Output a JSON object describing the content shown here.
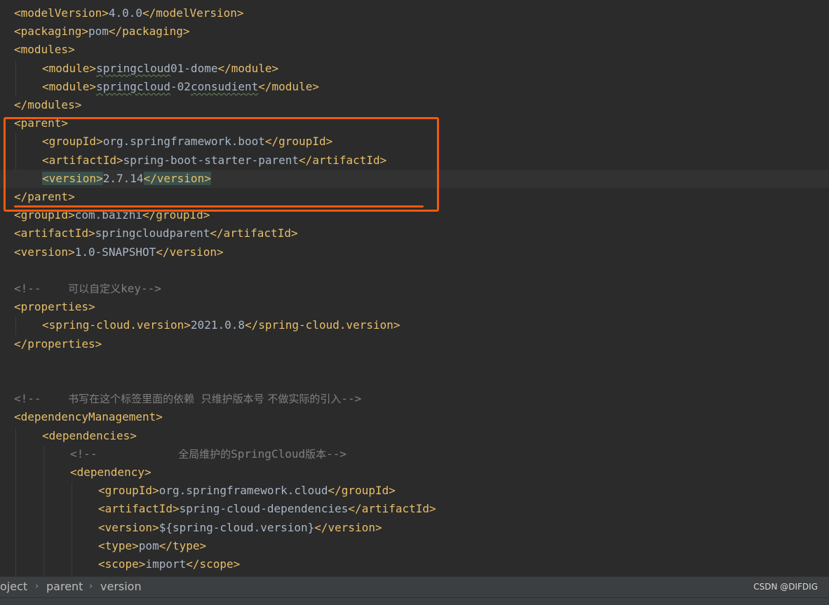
{
  "editor": {
    "lines": [
      {
        "i": 0,
        "parts": [
          [
            "tag",
            "<modelVersion>"
          ],
          [
            "txt",
            "4.0.0"
          ],
          [
            "tag",
            "</modelVersion>"
          ]
        ]
      },
      {
        "i": 0,
        "parts": [
          [
            "tag",
            "<packaging>"
          ],
          [
            "txt",
            "pom"
          ],
          [
            "tag",
            "</packaging>"
          ]
        ]
      },
      {
        "i": 0,
        "parts": [
          [
            "tag",
            "<modules>"
          ]
        ]
      },
      {
        "i": 1,
        "parts": [
          [
            "tag",
            "<module>"
          ],
          [
            "squig",
            "springcloud"
          ],
          [
            "txt",
            "01-dome"
          ],
          [
            "tag",
            "</module>"
          ]
        ]
      },
      {
        "i": 1,
        "parts": [
          [
            "tag",
            "<module>"
          ],
          [
            "squig",
            "springcloud"
          ],
          [
            "txt",
            "-02"
          ],
          [
            "squig",
            "consudient"
          ],
          [
            "tag",
            "</module>"
          ]
        ]
      },
      {
        "i": 0,
        "parts": [
          [
            "tag",
            "</modules>"
          ]
        ]
      },
      {
        "i": 0,
        "parts": [
          [
            "tag",
            "<parent>"
          ]
        ]
      },
      {
        "i": 1,
        "parts": [
          [
            "tag",
            "<groupId>"
          ],
          [
            "txt",
            "org.springframework.boot"
          ],
          [
            "tag",
            "</groupId>"
          ]
        ]
      },
      {
        "i": 1,
        "parts": [
          [
            "tag",
            "<artifactId>"
          ],
          [
            "txt",
            "spring-boot-starter-parent"
          ],
          [
            "tag",
            "</artifactId>"
          ]
        ]
      },
      {
        "i": 1,
        "hl": true,
        "parts": [
          [
            "hltag",
            "<version>"
          ],
          [
            "txt",
            "2.7.14"
          ],
          [
            "hltag",
            "</version>"
          ]
        ]
      },
      {
        "i": 0,
        "parts": [
          [
            "tag",
            "</parent>"
          ]
        ]
      },
      {
        "i": 0,
        "parts": [
          [
            "tag",
            "<groupId>"
          ],
          [
            "txt",
            "com.baizhi"
          ],
          [
            "tag",
            "</groupId>"
          ]
        ]
      },
      {
        "i": 0,
        "parts": [
          [
            "tag",
            "<artifactId>"
          ],
          [
            "txt",
            "springcloudparent"
          ],
          [
            "tag",
            "</artifactId>"
          ]
        ]
      },
      {
        "i": 0,
        "parts": [
          [
            "tag",
            "<version>"
          ],
          [
            "txt",
            "1.0-SNAPSHOT"
          ],
          [
            "tag",
            "</version>"
          ]
        ]
      },
      {
        "i": 0,
        "parts": []
      },
      {
        "i": 0,
        "parts": [
          [
            "cmt",
            "<!--    "
          ],
          [
            "cmtcjk",
            "可以自定义"
          ],
          [
            "cmt",
            "key-->"
          ]
        ]
      },
      {
        "i": 0,
        "parts": [
          [
            "tag",
            "<properties>"
          ]
        ]
      },
      {
        "i": 1,
        "parts": [
          [
            "tag",
            "<spring-cloud.version>"
          ],
          [
            "txt",
            "2021.0.8"
          ],
          [
            "tag",
            "</spring-cloud.version>"
          ]
        ]
      },
      {
        "i": 0,
        "parts": [
          [
            "tag",
            "</properties>"
          ]
        ]
      },
      {
        "i": 0,
        "parts": []
      },
      {
        "i": 0,
        "parts": []
      },
      {
        "i": 0,
        "parts": [
          [
            "cmt",
            "<!--    "
          ],
          [
            "cmtcjk",
            "书写在这个标签里面的依赖  只维护版本号 不做实际的引入"
          ],
          [
            "cmt",
            "-->"
          ]
        ]
      },
      {
        "i": 0,
        "parts": [
          [
            "tag",
            "<dependencyManagement>"
          ]
        ]
      },
      {
        "i": 1,
        "parts": [
          [
            "tag",
            "<dependencies>"
          ]
        ]
      },
      {
        "i": 2,
        "parts": [
          [
            "cmt",
            "<!--            "
          ],
          [
            "cmtcjk",
            "全局维护的"
          ],
          [
            "cmt",
            "SpringCloud"
          ],
          [
            "cmtcjk",
            "版本"
          ],
          [
            "cmt",
            "-->"
          ]
        ]
      },
      {
        "i": 2,
        "parts": [
          [
            "tag",
            "<dependency>"
          ]
        ]
      },
      {
        "i": 3,
        "parts": [
          [
            "tag",
            "<groupId>"
          ],
          [
            "txt",
            "org.springframework.cloud"
          ],
          [
            "tag",
            "</groupId>"
          ]
        ]
      },
      {
        "i": 3,
        "parts": [
          [
            "tag",
            "<artifactId>"
          ],
          [
            "txt",
            "spring-cloud-dependencies"
          ],
          [
            "tag",
            "</artifactId>"
          ]
        ]
      },
      {
        "i": 3,
        "parts": [
          [
            "tag",
            "<version>"
          ],
          [
            "txt",
            "${spring-cloud.version}"
          ],
          [
            "tag",
            "</version>"
          ]
        ]
      },
      {
        "i": 3,
        "parts": [
          [
            "tag",
            "<type>"
          ],
          [
            "txt",
            "pom"
          ],
          [
            "tag",
            "</type>"
          ]
        ]
      },
      {
        "i": 3,
        "parts": [
          [
            "tag",
            "<scope>"
          ],
          [
            "txt",
            "import"
          ],
          [
            "tag",
            "</scope>"
          ]
        ]
      }
    ]
  },
  "breadcrumb": {
    "items": [
      "oject",
      "parent",
      "version"
    ],
    "separator": "›"
  },
  "watermark": "CSDN @DIFDIG",
  "colors": {
    "background": "#2b2b2b",
    "tag": "#e8bf6a",
    "text": "#a9b7c6",
    "comment": "#808080",
    "annotation": "#f05a10",
    "tag_highlight": "#3b514d"
  }
}
